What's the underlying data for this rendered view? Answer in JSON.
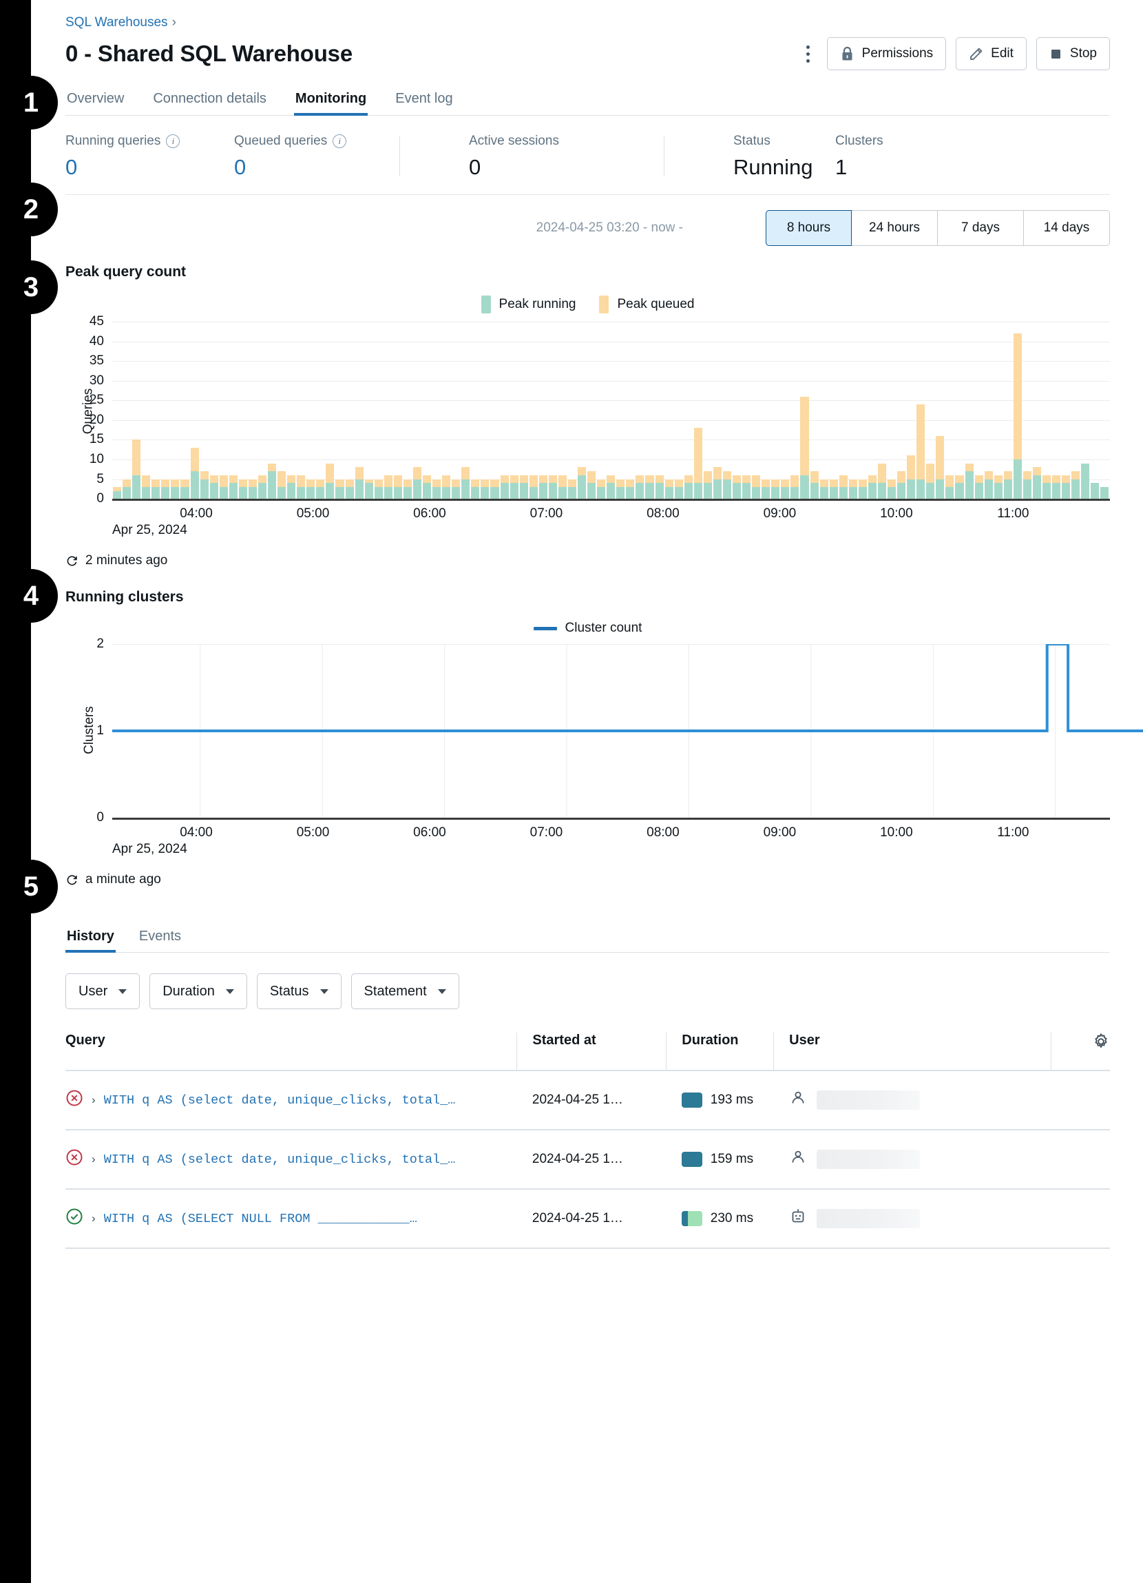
{
  "rail": {
    "badges": [
      {
        "n": "1",
        "top": 110
      },
      {
        "n": "2",
        "top": 265
      },
      {
        "n": "3",
        "top": 378
      },
      {
        "n": "4",
        "top": 826
      },
      {
        "n": "5",
        "top": 1248
      }
    ]
  },
  "breadcrumb": {
    "parent": "SQL Warehouses",
    "separator": "›"
  },
  "header": {
    "title": "0 - Shared SQL Warehouse",
    "kebab_label": "more-options",
    "buttons": [
      {
        "label": "Permissions",
        "icon": "lock-icon"
      },
      {
        "label": "Edit",
        "icon": "pencil-icon"
      },
      {
        "label": "Stop",
        "icon": "stop-square-icon"
      }
    ]
  },
  "tabs": [
    {
      "label": "Overview",
      "active": false
    },
    {
      "label": "Connection details",
      "active": false
    },
    {
      "label": "Monitoring",
      "active": true
    },
    {
      "label": "Event log",
      "active": false
    }
  ],
  "metrics": [
    {
      "label": "Running queries",
      "value": "0",
      "info": true,
      "link": true
    },
    {
      "label": "Queued queries",
      "value": "0",
      "info": true,
      "link": true
    },
    {
      "label": "Active sessions",
      "value": "0",
      "info": false,
      "link": false
    },
    {
      "label": "Status",
      "value": "Running",
      "info": false,
      "link": false
    },
    {
      "label": "Clusters",
      "value": "1",
      "info": false,
      "link": false
    }
  ],
  "timerange": {
    "text": "2024-04-25 03:20 - now -",
    "options": [
      "8 hours",
      "24 hours",
      "7 days",
      "14 days"
    ],
    "selected": "8 hours"
  },
  "peak_chart": {
    "title": "Peak query count",
    "refreshed": "2 minutes ago",
    "date_label": "Apr 25, 2024"
  },
  "clusters_chart": {
    "title": "Running clusters",
    "refreshed": "a minute ago",
    "date_label": "Apr 25, 2024"
  },
  "bottom_tabs": [
    {
      "label": "History",
      "active": true
    },
    {
      "label": "Events",
      "active": false
    }
  ],
  "filters": [
    {
      "label": "User"
    },
    {
      "label": "Duration"
    },
    {
      "label": "Status"
    },
    {
      "label": "Statement"
    }
  ],
  "table": {
    "columns": [
      "Query",
      "Started at",
      "Duration",
      "User"
    ],
    "settings_icon": "gear-icon",
    "rows": [
      {
        "status": "failed",
        "query": "WITH q AS (select date, unique_clicks, total_…",
        "started_at": "2024-04-25 1…",
        "duration": "193 ms",
        "duration_style": "solid",
        "user_icon": "person-icon",
        "user": ""
      },
      {
        "status": "failed",
        "query": "WITH q AS (select date, unique_clicks, total_…",
        "started_at": "2024-04-25 1…",
        "duration": "159 ms",
        "duration_style": "solid",
        "user_icon": "person-icon",
        "user": ""
      },
      {
        "status": "success",
        "query": "WITH q AS (SELECT NULL FROM ____________…",
        "started_at": "2024-04-25 1…",
        "duration": "230 ms",
        "duration_style": "split",
        "user_icon": "robot-icon",
        "user": ""
      }
    ]
  },
  "colors": {
    "peak_running": "#a4d9c9",
    "peak_queued": "#fcd9a1",
    "cluster_line": "#2e8fd6",
    "accent": "#2272b4"
  },
  "chart_data": [
    {
      "type": "bar",
      "title": "Peak query count",
      "stacked": true,
      "xlabel": "",
      "ylabel": "Queries",
      "ylim": [
        0,
        45
      ],
      "yticks": [
        0,
        5,
        10,
        15,
        20,
        25,
        30,
        35,
        40,
        45
      ],
      "grid": true,
      "legend": [
        "Peak running",
        "Peak queued"
      ],
      "legend_position": "top-center",
      "x_tick_labels": [
        "04:00",
        "05:00",
        "06:00",
        "07:00",
        "08:00",
        "09:00",
        "10:00",
        "11:00"
      ],
      "x_date": "Apr 25, 2024",
      "series": [
        {
          "name": "Peak running",
          "color": "#a4d9c9",
          "values": [
            2,
            3,
            6,
            3,
            3,
            3,
            3,
            3,
            7,
            5,
            4,
            3,
            4,
            3,
            3,
            4,
            7,
            3,
            4,
            3,
            3,
            3,
            4,
            3,
            3,
            5,
            4,
            3,
            3,
            3,
            3,
            5,
            4,
            3,
            3,
            3,
            5,
            3,
            3,
            3,
            4,
            4,
            4,
            3,
            4,
            4,
            3,
            3,
            6,
            4,
            3,
            4,
            3,
            3,
            4,
            4,
            4,
            3,
            3,
            4,
            4,
            4,
            5,
            5,
            4,
            4,
            3,
            3,
            3,
            3,
            3,
            6,
            4,
            3,
            3,
            3,
            3,
            3,
            4,
            4,
            3,
            4,
            5,
            5,
            4,
            5,
            3,
            4,
            7,
            4,
            5,
            4,
            5,
            10,
            5,
            6,
            4,
            4,
            4,
            5,
            9,
            4,
            3
          ]
        },
        {
          "name": "Peak queued",
          "color": "#fcd9a1",
          "values": [
            1,
            2,
            9,
            3,
            2,
            2,
            2,
            2,
            6,
            2,
            2,
            3,
            2,
            2,
            2,
            2,
            2,
            4,
            2,
            3,
            2,
            2,
            5,
            2,
            2,
            3,
            1,
            2,
            3,
            3,
            2,
            3,
            2,
            2,
            3,
            2,
            3,
            2,
            2,
            2,
            2,
            2,
            2,
            3,
            2,
            2,
            3,
            2,
            2,
            3,
            2,
            2,
            2,
            2,
            2,
            2,
            2,
            2,
            2,
            2,
            14,
            3,
            3,
            2,
            2,
            2,
            3,
            2,
            2,
            2,
            3,
            20,
            3,
            2,
            2,
            3,
            2,
            2,
            2,
            5,
            2,
            3,
            6,
            19,
            5,
            11,
            3,
            2,
            2,
            2,
            2,
            2,
            2,
            32,
            2,
            2,
            2,
            2,
            2,
            2,
            0,
            0,
            0
          ]
        }
      ]
    },
    {
      "type": "line",
      "title": "Running clusters",
      "xlabel": "",
      "ylabel": "Clusters",
      "ylim": [
        0,
        2
      ],
      "yticks": [
        0,
        1,
        2
      ],
      "grid": true,
      "legend": [
        "Cluster count"
      ],
      "legend_position": "top-center",
      "x_tick_labels": [
        "04:00",
        "05:00",
        "06:00",
        "07:00",
        "08:00",
        "09:00",
        "10:00",
        "11:00"
      ],
      "x_date": "Apr 25, 2024",
      "series": [
        {
          "name": "Cluster count",
          "color": "#2e8fd6",
          "points": [
            {
              "x": 0.0,
              "y": 1
            },
            {
              "x": 0.895,
              "y": 1
            },
            {
              "x": 0.895,
              "y": 2
            },
            {
              "x": 0.915,
              "y": 2
            },
            {
              "x": 0.915,
              "y": 1
            },
            {
              "x": 1.0,
              "y": 1
            }
          ]
        }
      ]
    }
  ]
}
